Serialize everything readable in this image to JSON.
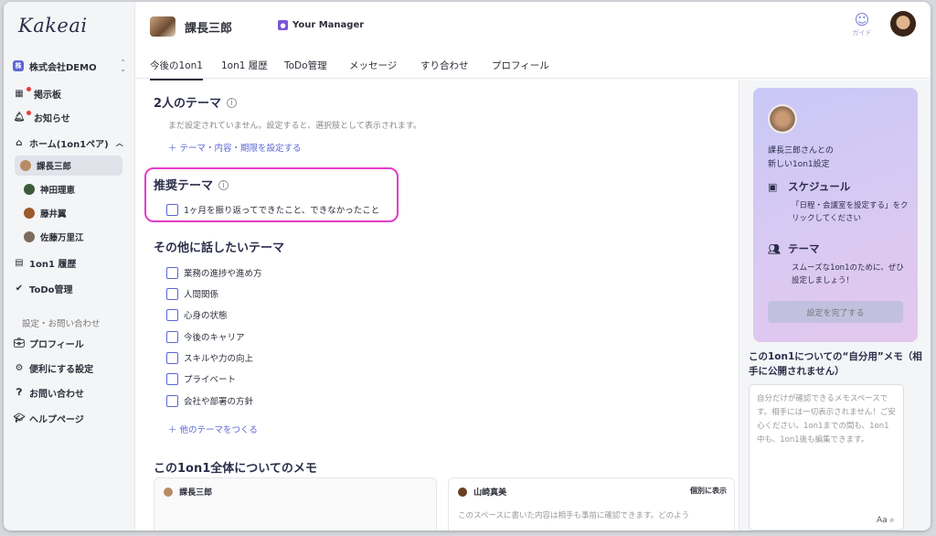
{
  "app": {
    "logo": "Kakeai",
    "org": "株式会社DEMO",
    "org_badge": "株"
  },
  "sidebar": {
    "items": [
      {
        "label": "掲示板",
        "icon": "board-icon"
      },
      {
        "label": "お知らせ",
        "icon": "bell-icon"
      },
      {
        "label": "ホーム(1on1ペア)",
        "icon": "home-icon"
      }
    ],
    "members": [
      "課長三郎",
      "神田理恵",
      "藤井翼",
      "佐藤万里江"
    ],
    "items2": [
      {
        "label": "1on1 履歴",
        "icon": "history-icon"
      },
      {
        "label": "ToDo管理",
        "icon": "check-circle-icon"
      }
    ],
    "settings_label": "設定・お問い合わせ",
    "settings": [
      {
        "label": "プロフィール",
        "icon": "briefcase-icon"
      },
      {
        "label": "便利にする設定",
        "icon": "gear-icon"
      },
      {
        "label": "お問い合わせ",
        "icon": "question-icon"
      },
      {
        "label": "ヘルプページ",
        "icon": "graduation-cap-icon"
      }
    ]
  },
  "header": {
    "user": "課長三郎",
    "role": "Your Manager",
    "guide": "ガイド"
  },
  "tabs": [
    "今後の1on1",
    "1on1 履歴",
    "ToDo管理",
    "メッセージ",
    "すり合わせ",
    "プロフィール"
  ],
  "main": {
    "theme2_title": "2人のテーマ",
    "theme2_empty": "まだ設定されていません。設定すると、選択肢として表示されます。",
    "theme2_link": "＋ テーマ・内容・期限を設定する",
    "rec_title": "推奨テーマ",
    "rec_item": "1ヶ月を振り返ってできたこと、できなかったこと",
    "other_title": "その他に話したいテーマ",
    "other_items": [
      "業務の進捗や進め方",
      "人間関係",
      "心身の状態",
      "今後のキャリア",
      "スキルや力の向上",
      "プライベート",
      "会社や部署の方針"
    ],
    "other_link": "＋ 他のテーマをつくる",
    "memo_title": "この1on1全体についてのメモ",
    "memo_tab1": "課長三郎",
    "memo_tab2": "山崎真美",
    "memo_toggle": "個別に表示",
    "memo_hint": "このスペースに書いた内容は相手も事前に確認できます。どのよう"
  },
  "right": {
    "card_intro": "課長三郎さんとの",
    "card_intro2": "新しい1on1設定",
    "schedule_title": "スケジュール",
    "schedule_desc": "「日程・会議室を設定する」をクリックしてください",
    "theme_title": "テーマ",
    "theme_desc": "スムーズな1on1のために、ぜひ設定しましょう！",
    "complete_btn": "設定を完了する",
    "memo_title": "この1on1についての“自分用”メモ（相手に公開されません）",
    "memo_placeholder": "自分だけが確認できるメモスペースです。相手には一切表示されません！ご安心ください。1on1までの間も、1on1中も、1on1後も編集できます。",
    "font_label": "Aa"
  },
  "colors": {
    "accent": "#5a66d6",
    "highlight": "#e53bc8"
  }
}
